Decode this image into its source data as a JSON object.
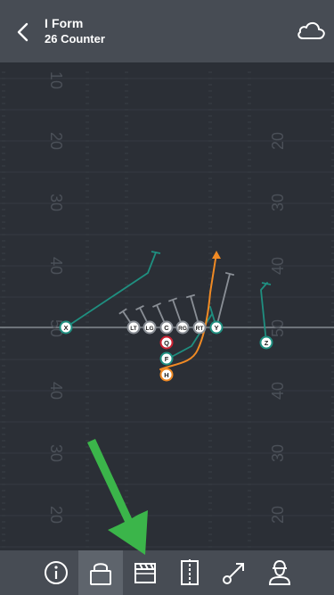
{
  "header": {
    "formation": "I Form",
    "play": "26 Counter",
    "back_icon": "chevron-left-icon",
    "cloud_icon": "cloud-icon"
  },
  "field": {
    "yard_lines": [
      {
        "label": "10",
        "side": "left"
      },
      {
        "label": "20",
        "side": "left"
      },
      {
        "label": "30",
        "side": "left"
      },
      {
        "label": "40",
        "side": "left"
      },
      {
        "label": "50",
        "side": "left"
      },
      {
        "label": "40",
        "side": "left"
      },
      {
        "label": "30",
        "side": "left"
      },
      {
        "label": "20",
        "side": "left"
      },
      {
        "label": "20",
        "side": "right"
      },
      {
        "label": "30",
        "side": "right"
      },
      {
        "label": "40",
        "side": "right"
      },
      {
        "label": "50",
        "side": "right"
      },
      {
        "label": "40",
        "side": "right"
      },
      {
        "label": "30",
        "side": "right"
      },
      {
        "label": "20",
        "side": "right"
      }
    ]
  },
  "players": [
    {
      "label": "X",
      "role": "receiver"
    },
    {
      "label": "LT",
      "role": "lineman"
    },
    {
      "label": "LG",
      "role": "lineman"
    },
    {
      "label": "C",
      "role": "lineman"
    },
    {
      "label": "RG",
      "role": "lineman"
    },
    {
      "label": "RT",
      "role": "lineman"
    },
    {
      "label": "Y",
      "role": "tight-end"
    },
    {
      "label": "Q",
      "role": "quarterback"
    },
    {
      "label": "F",
      "role": "fullback"
    },
    {
      "label": "H",
      "role": "halfback"
    },
    {
      "label": "Z",
      "role": "receiver"
    }
  ],
  "colors": {
    "background": "#2b2f36",
    "bars": "#474c54",
    "route_teal": "#1f8f80",
    "route_orange": "#f08a24",
    "block_gray": "#8a8f96",
    "qb_red": "#cc2233",
    "annotation_arrow": "#3bb54a"
  },
  "toolbar": [
    {
      "name": "info",
      "icon": "info-icon",
      "active": false
    },
    {
      "name": "lock",
      "icon": "lock-icon",
      "active": true
    },
    {
      "name": "clapperboard",
      "icon": "clapperboard-icon",
      "active": false
    },
    {
      "name": "flip",
      "icon": "flip-icon",
      "active": false
    },
    {
      "name": "route",
      "icon": "route-line-icon",
      "active": false
    },
    {
      "name": "coach",
      "icon": "coach-icon",
      "active": false
    }
  ]
}
